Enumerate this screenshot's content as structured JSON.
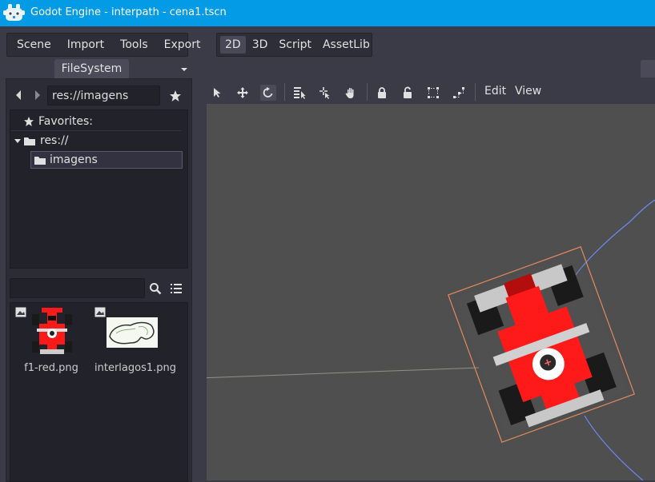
{
  "window": {
    "title": "Godot Engine - interpath - cena1.tscn"
  },
  "menubar": {
    "items": [
      "Scene",
      "Import",
      "Tools",
      "Export"
    ]
  },
  "main_menu": {
    "items": [
      "2D",
      "3D",
      "Script",
      "AssetLib"
    ],
    "active": "2D"
  },
  "filesystem_dock": {
    "tab_label": "FileSystem",
    "path": "res://imagens",
    "tree": {
      "favorites_label": "Favorites:",
      "root_label": "res://",
      "folders": [
        "imagens"
      ]
    },
    "search": {
      "value": ""
    },
    "files": [
      {
        "name": "f1-red.png",
        "icon": "image-icon"
      },
      {
        "name": "interlagos1.png",
        "icon": "image-icon"
      }
    ]
  },
  "viewport_toolbar": {
    "tools": [
      "select-icon",
      "move-icon",
      "rotate-icon",
      "list-select-icon",
      "pivot-icon",
      "pan-icon",
      "lock-icon",
      "unlock-icon",
      "group-icon",
      "ungroup-icon"
    ],
    "active_tool": "rotate-icon",
    "menus": {
      "edit": "Edit",
      "view": "View"
    }
  },
  "colors": {
    "titlebar": "#039be5",
    "path_line": "#6b8bf5",
    "selection_box": "#e08a5c",
    "car_red": "#ff1a1a"
  }
}
